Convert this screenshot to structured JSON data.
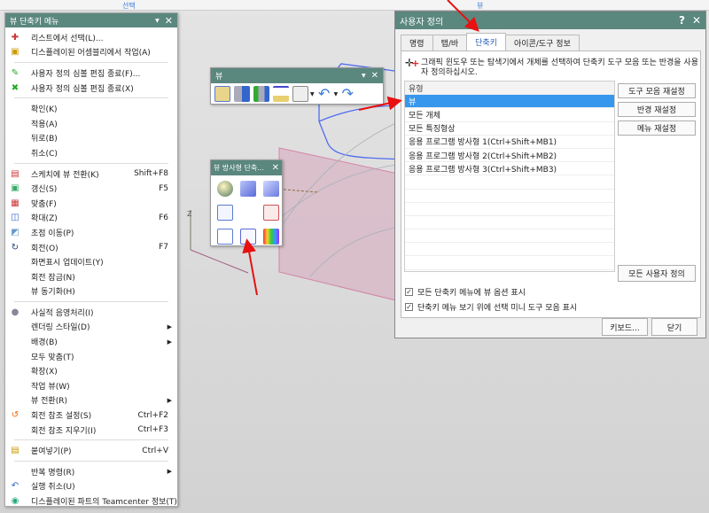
{
  "top": {
    "left_label": "선택",
    "right_label": "뷰"
  },
  "menu": {
    "title": "뷰 단축키 메뉴",
    "groups": [
      [
        {
          "icon": "select-from-list-icon",
          "label": "리스트에서 선택(L)..."
        },
        {
          "icon": "assembly-icon",
          "label": "디스플레이된 어셈블리에서 작업(A)"
        }
      ],
      [
        {
          "icon": "edit-symbol-icon",
          "label": "사용자 정의 심볼 편집 종료(F)..."
        },
        {
          "icon": "exit-symbol-icon",
          "label": "사용자 정의 심볼 편집 종료(X)"
        }
      ],
      [
        {
          "label": "확인(K)"
        },
        {
          "label": "적용(A)"
        },
        {
          "label": "뒤로(B)"
        },
        {
          "label": "취소(C)"
        }
      ],
      [
        {
          "icon": "sketch-view-icon",
          "label": "스케치에 뷰 전환(K)",
          "shortcut": "Shift+F8"
        },
        {
          "icon": "refresh-icon",
          "label": "갱신(S)",
          "shortcut": "F5"
        },
        {
          "icon": "fit-icon",
          "label": "맞춤(F)"
        },
        {
          "icon": "zoom-icon",
          "label": "확대(Z)",
          "shortcut": "F6"
        },
        {
          "icon": "pan-icon",
          "label": "초점 이동(P)"
        },
        {
          "icon": "rotate-icon",
          "label": "회전(O)",
          "shortcut": "F7"
        },
        {
          "label": "화면표시 업데이트(Y)"
        },
        {
          "label": "회전 잠금(N)"
        },
        {
          "label": "뷰 동기화(H)"
        }
      ],
      [
        {
          "icon": "shading-icon",
          "label": "사실적 음영처리(I)"
        },
        {
          "label": "렌더링 스타일(D)",
          "submenu": true
        },
        {
          "label": "배경(B)",
          "submenu": true
        },
        {
          "label": "모두 맞춤(T)"
        },
        {
          "label": "확장(X)"
        },
        {
          "label": "작업 뷰(W)"
        },
        {
          "label": "뷰 전환(R)",
          "submenu": true
        },
        {
          "icon": "rotation-ref-icon",
          "label": "회전 참조 설정(S)",
          "shortcut": "Ctrl+F2"
        },
        {
          "label": "회전 참조 지우기(I)",
          "shortcut": "Ctrl+F3"
        }
      ],
      [
        {
          "icon": "paste-icon",
          "label": "붙여넣기(P)",
          "shortcut": "Ctrl+V"
        }
      ],
      [
        {
          "label": "반복 명령(R)",
          "submenu": true
        },
        {
          "icon": "undo-icon",
          "label": "실행 취소(U)"
        },
        {
          "icon": "teamcenter-icon",
          "label": "디스플레이된 파트의 Teamcenter 정보(T)"
        }
      ]
    ]
  },
  "view_toolbar": {
    "title": "뷰"
  },
  "radial_toolbar": {
    "title": "뷰 방사형 단축..."
  },
  "dialog": {
    "title": "사용자 정의",
    "help": "?",
    "tabs": [
      "명령",
      "탭/바",
      "단축키",
      "아이콘/도구 정보"
    ],
    "active_tab": 2,
    "instruction": "그래픽 윈도우 또는 탐색기에서 개체를 선택하여 단축키 도구 모음 또는 반경을 사용자 정의하십시오.",
    "list_header": "유형",
    "list_items": [
      "뷰",
      "모든 개체",
      "모든 특징형상",
      "응용 프로그램 방사형 1(Ctrl+Shift+MB1)",
      "응용 프로그램 방사형 2(Ctrl+Shift+MB2)",
      "응용 프로그램 방사형 3(Ctrl+Shift+MB3)"
    ],
    "selected_item": 0,
    "buttons": {
      "reset_toolbar": "도구 모음 재설정",
      "reset_radial": "반경 재설정",
      "reset_menu": "메뉴 재설정",
      "reset_all": "모든 사용자 정의",
      "keyboard": "키보드...",
      "close": "닫기"
    },
    "checkboxes": [
      {
        "label": "모든 단축키 메뉴에 뷰 옵션 표시",
        "checked": true
      },
      {
        "label": "단축키 메뉴 보기 위에 선택 미니 도구 모음 표시",
        "checked": true
      }
    ]
  },
  "colors": {
    "titlebar": "#5a877e",
    "selection": "#3797ec",
    "arrow": "#e81010"
  }
}
